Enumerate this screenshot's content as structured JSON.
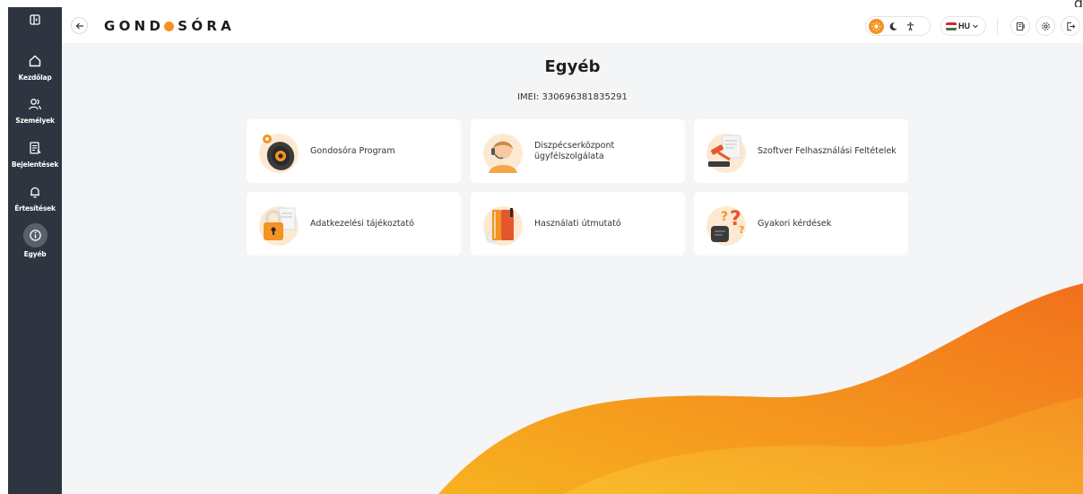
{
  "sidebar": {
    "toggle_icon": "panel-toggle-icon",
    "items": [
      {
        "label": "Kezdőlap",
        "icon": "home-icon"
      },
      {
        "label": "Személyek",
        "icon": "people-icon"
      },
      {
        "label": "Bejelentések",
        "icon": "report-icon"
      },
      {
        "label": "Értesítések",
        "icon": "bell-icon"
      },
      {
        "label": "Egyéb",
        "icon": "info-icon",
        "active": true
      }
    ]
  },
  "header": {
    "logo_left": "GOND",
    "logo_right": "SÓRA",
    "language": "HU",
    "accent_color": "#f39321"
  },
  "page": {
    "title": "Egyéb",
    "imei": "IMEI: 330696381835291"
  },
  "cards": [
    {
      "label": "Gondosóra Program",
      "icon": "smartwatch-icon"
    },
    {
      "label": "Diszpécserközpont ügyfélszolgálata",
      "icon": "dispatcher-icon"
    },
    {
      "label": "Szoftver Felhasználási Feltételek",
      "icon": "gavel-icon"
    },
    {
      "label": "Adatkezelési tájékoztató",
      "icon": "padlock-icon"
    },
    {
      "label": "Használati útmutató",
      "icon": "manual-icon"
    },
    {
      "label": "Gyakori kérdések",
      "icon": "faq-icon"
    }
  ],
  "colors": {
    "sidebar_bg": "#2f3540",
    "content_bg": "#f4f5f7",
    "orange": "#f39321"
  }
}
